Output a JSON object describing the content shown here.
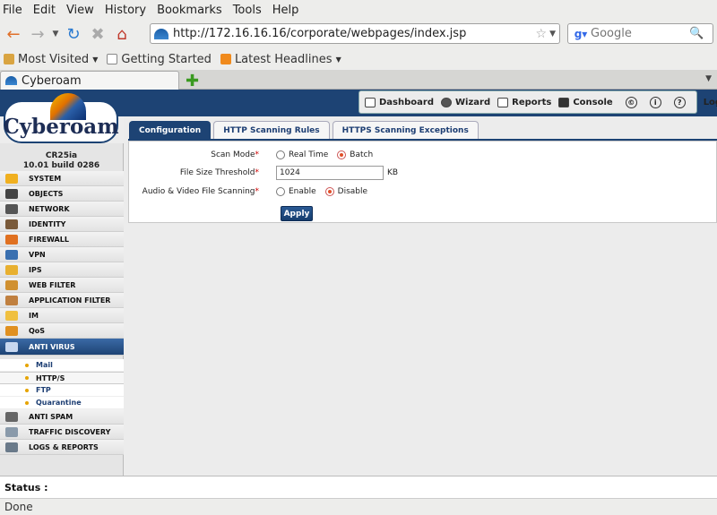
{
  "browser": {
    "menu": [
      "File",
      "Edit",
      "View",
      "History",
      "Bookmarks",
      "Tools",
      "Help"
    ],
    "url": "http://172.16.16.16/corporate/webpages/index.jsp",
    "search_placeholder": "Google",
    "bookmarks": [
      "Most Visited",
      "Getting Started",
      "Latest Headlines"
    ],
    "tab_title": "Cyberoam",
    "status_done": "Done"
  },
  "app": {
    "logo": "Cyberoam",
    "device_model": "CR25ia",
    "device_build": "10.01 build 0286",
    "toplinks": [
      "Dashboard",
      "Wizard",
      "Reports",
      "Console",
      "Logout"
    ],
    "menu": [
      "SYSTEM",
      "OBJECTS",
      "NETWORK",
      "IDENTITY",
      "FIREWALL",
      "VPN",
      "IPS",
      "WEB FILTER",
      "APPLICATION FILTER",
      "IM",
      "QoS",
      "ANTI VIRUS",
      "ANTI SPAM",
      "TRAFFIC DISCOVERY",
      "LOGS & REPORTS"
    ],
    "submenu": [
      "Mail",
      "HTTP/S",
      "FTP",
      "Quarantine"
    ],
    "tabs": [
      "Configuration",
      "HTTP Scanning Rules",
      "HTTPS Scanning Exceptions"
    ],
    "form": {
      "scan_mode_label": "Scan Mode",
      "scan_mode_options": [
        "Real Time",
        "Batch"
      ],
      "file_size_label": "File Size Threshold",
      "file_size_value": "1024",
      "file_size_unit": "KB",
      "av_label": "Audio & Video File Scanning",
      "av_options": [
        "Enable",
        "Disable"
      ],
      "apply": "Apply",
      "required_mark": "*"
    },
    "status_label": "Status :"
  }
}
